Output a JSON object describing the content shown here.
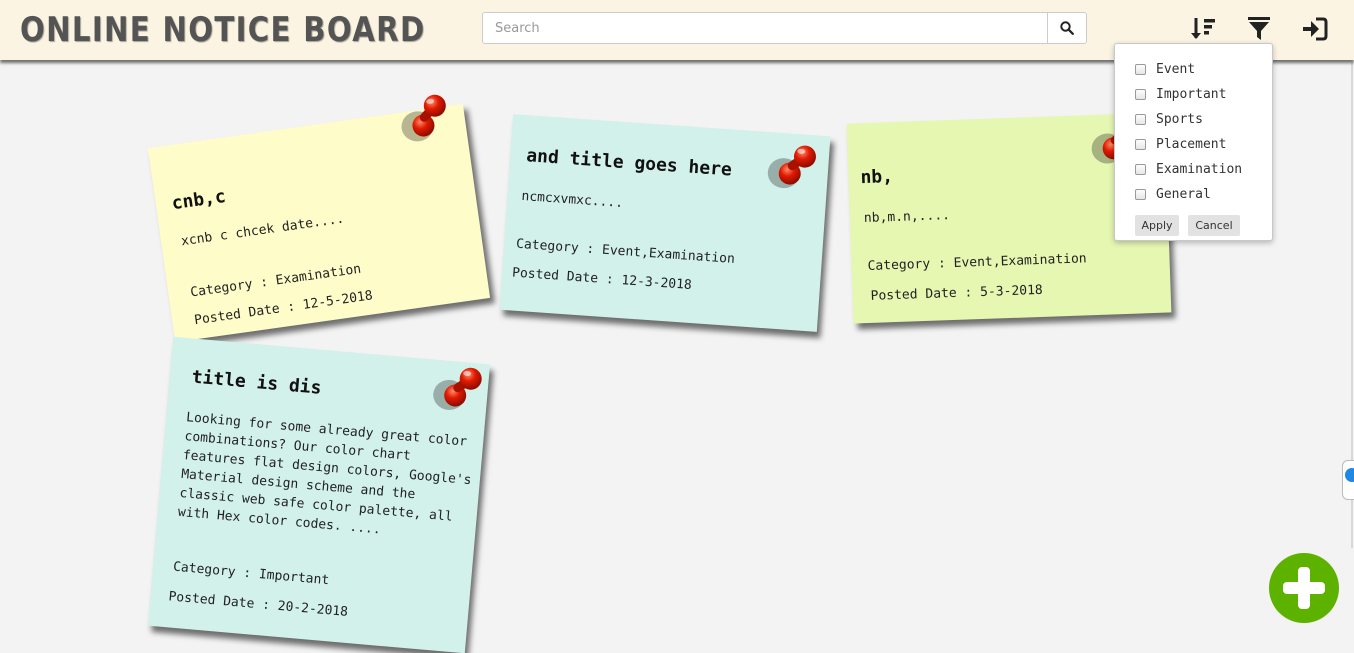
{
  "header": {
    "app_title": "ONLINE NOTICE BOARD",
    "search_placeholder": "Search",
    "icons": [
      "sort-icon",
      "filter-icon",
      "logout-icon"
    ]
  },
  "notes": [
    {
      "title": "cnb,c",
      "body": "xcnb c chcek date....",
      "category_label": "Category : Examination",
      "date_label": "Posted Date : 12-5-2018",
      "color": "#fefcc8"
    },
    {
      "title": "and title goes here",
      "body": "ncmcxvmxc....",
      "category_label": "Category : Event,Examination",
      "date_label": "Posted Date : 12-3-2018",
      "color": "#d2f1ea"
    },
    {
      "title": "nb,",
      "body": "nb,m.n,....",
      "category_label": "Category : Event,Examination",
      "date_label": "Posted Date : 5-3-2018",
      "color": "#e6f7b2"
    },
    {
      "title": "title is dis",
      "body_lines": [
        "Looking for some already great color",
        "combinations? Our color chart",
        "features flat design colors, Google's",
        "Material design scheme and the",
        "classic web safe color palette, all",
        "with Hex color codes. ...."
      ],
      "category_label": "Category : Important",
      "date_label": "Posted Date : 20-2-2018",
      "color": "#d2f1ea"
    }
  ],
  "filter_menu": {
    "options": [
      "Event",
      "Important",
      "Sports",
      "Placement",
      "Examination",
      "General"
    ],
    "apply_label": "Apply",
    "cancel_label": "Cancel"
  },
  "colors": {
    "header_bg": "#fbf4e3",
    "fab": "#5db200",
    "pin": "#d01d00"
  }
}
